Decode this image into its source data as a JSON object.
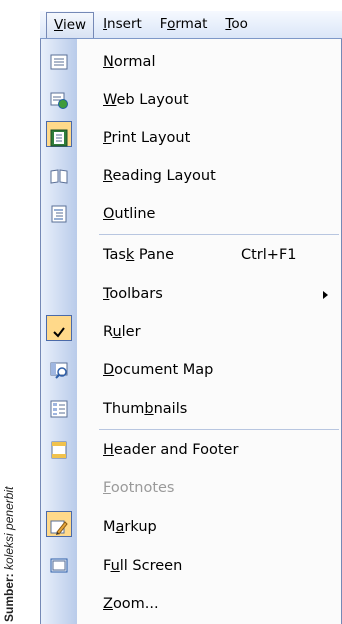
{
  "source_note": {
    "strong": "Sumber:",
    "em": "koleksi penerbit"
  },
  "menubar": {
    "items": [
      "View",
      "Insert",
      "Format",
      "Too"
    ]
  },
  "menu": {
    "items": [
      {
        "label": "Normal",
        "icon": "normal-view-icon"
      },
      {
        "label": "Web Layout",
        "icon": "web-layout-icon"
      },
      {
        "label": "Print Layout",
        "icon": "print-layout-icon",
        "checked": true
      },
      {
        "label": "Reading Layout",
        "icon": "reading-layout-icon"
      },
      {
        "label": "Outline",
        "icon": "outline-view-icon"
      },
      {
        "label": "Task Pane",
        "shortcut": "Ctrl+F1"
      },
      {
        "label": "Toolbars",
        "submenu": true
      },
      {
        "label": "Ruler",
        "icon": "checkmark-icon",
        "checked": true
      },
      {
        "label": "Document Map",
        "icon": "document-map-icon"
      },
      {
        "label": "Thumbnails",
        "icon": "thumbnails-icon"
      },
      {
        "label": "Header and Footer",
        "icon": "header-footer-icon"
      },
      {
        "label": "Footnotes",
        "disabled": true
      },
      {
        "label": "Markup",
        "icon": "markup-icon",
        "checked": true
      },
      {
        "label": "Full Screen",
        "icon": "full-screen-icon"
      },
      {
        "label": "Zoom..."
      }
    ]
  }
}
